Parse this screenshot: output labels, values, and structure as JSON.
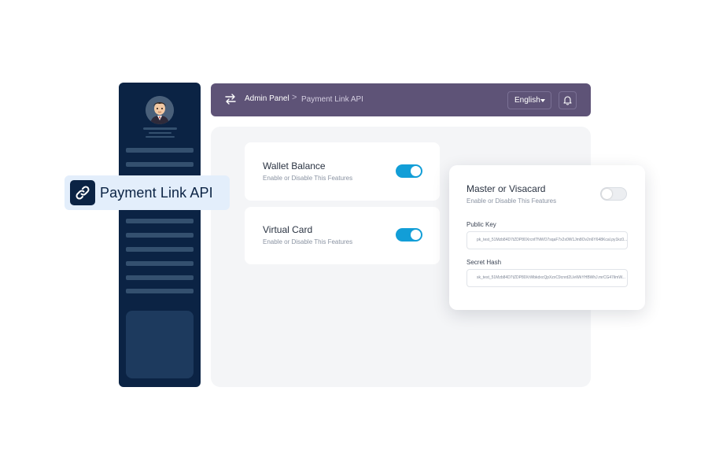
{
  "header": {
    "breadcrumb_home": "Admin Panel",
    "breadcrumb_separator": ">",
    "breadcrumb_current": "Payment Link API",
    "language": "English"
  },
  "badge": {
    "label": "Payment Link API"
  },
  "settings": {
    "wallet": {
      "title": "Wallet Balance",
      "subtitle": "Enable or Disable This Features",
      "enabled": true
    },
    "virtual_card": {
      "title": "Virtual Card",
      "subtitle": "Enable or Disable This Features",
      "enabled": true
    },
    "master_visa": {
      "title": "Master or Visacard",
      "subtitle": "Enable or Disable This Features",
      "enabled": false,
      "public_key_label": "Public Key",
      "public_key_value": "pk_test_51Mzb84D7tZDP80Xrcnf7NWO7sqaF7x2x0W1Jm8Ov2n6Y648Kcal.py1kc0...",
      "secret_hash_label": "Secret Hash",
      "secret_hash_value": "sk_test_51Mzb84D7tZDP80XrWbkdxcQpXzxC9cnrd2LIeWkYHBWhJ.mrCG47ilmW..."
    }
  },
  "colors": {
    "sidebar": "#0b2344",
    "header": "#5e5377",
    "toggle_on": "#129ed7",
    "badge_bg": "#e3eefb"
  },
  "icons": {
    "header_menu": "swap-arrows-icon",
    "notifications": "bell-icon",
    "badge": "link-icon"
  }
}
